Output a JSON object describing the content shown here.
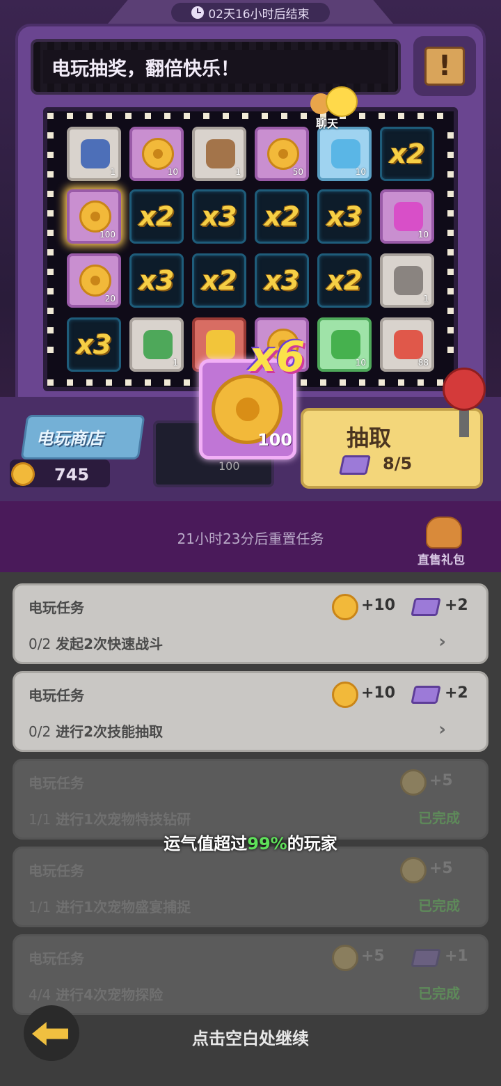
{
  "header": {
    "timer": "02天16小时后结束",
    "banner_text": "电玩抽奖，翻倍快乐！",
    "excl_symbol": "!"
  },
  "chat": {
    "label": "聊天"
  },
  "grid": {
    "row1": [
      {
        "kind": "gray",
        "count": "1",
        "icon": "blue-crystal-icon"
      },
      {
        "kind": "purple",
        "count": "10",
        "icon": "paw-coin-icon"
      },
      {
        "kind": "gray",
        "count": "1",
        "icon": "video-card-icon"
      },
      {
        "kind": "purple",
        "count": "50",
        "icon": "paw-coin-icon"
      },
      {
        "kind": "blue",
        "count": "10",
        "icon": "blue-paint-icon"
      },
      {
        "kind": "mult",
        "text": "x2"
      }
    ],
    "row2": [
      {
        "kind": "purple",
        "count": "100",
        "icon": "paw-coin-icon",
        "glow": true
      },
      {
        "kind": "mult",
        "text": "x2"
      },
      {
        "kind": "mult",
        "text": "x3"
      },
      {
        "kind": "mult",
        "text": "x2"
      },
      {
        "kind": "mult",
        "text": "x3"
      },
      {
        "kind": "purple",
        "count": "10",
        "icon": "pink-paint-icon"
      }
    ],
    "row3": [
      {
        "kind": "purple",
        "count": "20",
        "icon": "paw-coin-icon"
      },
      {
        "kind": "mult",
        "text": "x3"
      },
      {
        "kind": "mult",
        "text": "x2"
      },
      {
        "kind": "mult",
        "text": "x3"
      },
      {
        "kind": "mult",
        "text": "x2"
      },
      {
        "kind": "gray",
        "count": "1",
        "icon": "scroll-card-icon"
      }
    ],
    "row4": [
      {
        "kind": "mult",
        "text": "x3"
      },
      {
        "kind": "gray",
        "count": "1",
        "icon": "green-card-icon"
      },
      {
        "kind": "red",
        "count": "",
        "icon": "trophy-icon"
      },
      {
        "kind": "purple",
        "count": "",
        "icon": "paw-coin-icon"
      },
      {
        "kind": "green",
        "count": "10",
        "icon": "green-paint-icon"
      },
      {
        "kind": "gray",
        "count": "88",
        "icon": "starfish-icon"
      }
    ]
  },
  "prize": {
    "multiplier": "x6",
    "count": "100"
  },
  "console": {
    "shop_label": "电玩商店",
    "coin_balance": "745",
    "slot_count": "100",
    "draw_label": "抽取",
    "draw_tickets": "8/5"
  },
  "tasks_header": {
    "reset_text": "21小时23分后重置任务",
    "gift_label": "直售礼包"
  },
  "tasks": [
    {
      "title": "电玩任务",
      "progress": "0/2",
      "desc": "发起2次快速战斗",
      "coin_reward": "+10",
      "ticket_reward": "+2",
      "status": "go"
    },
    {
      "title": "电玩任务",
      "progress": "0/2",
      "desc": "进行2次技能抽取",
      "coin_reward": "+10",
      "ticket_reward": "+2",
      "status": "go"
    },
    {
      "title": "电玩任务",
      "progress": "1/1",
      "desc": "进行1次宠物特技钻研",
      "coin_reward": "+5",
      "ticket_reward": "",
      "status": "已完成"
    },
    {
      "title": "电玩任务",
      "progress": "1/1",
      "desc": "进行1次宠物盛宴捕捉",
      "coin_reward": "+5",
      "ticket_reward": "",
      "status": "已完成"
    },
    {
      "title": "电玩任务",
      "progress": "4/4",
      "desc": "进行4次宠物探险",
      "coin_reward": "+5",
      "ticket_reward": "+1",
      "status": "已完成"
    }
  ],
  "overlay": {
    "luck_prefix": "运气值超过",
    "luck_percent": "99%",
    "luck_suffix": "的玩家",
    "continue_text": "点击空白处继续"
  },
  "colors": {
    "accent_yellow": "#f6cf45",
    "highlight_green": "#5fe05a",
    "purple_header": "#4a1a5a"
  }
}
